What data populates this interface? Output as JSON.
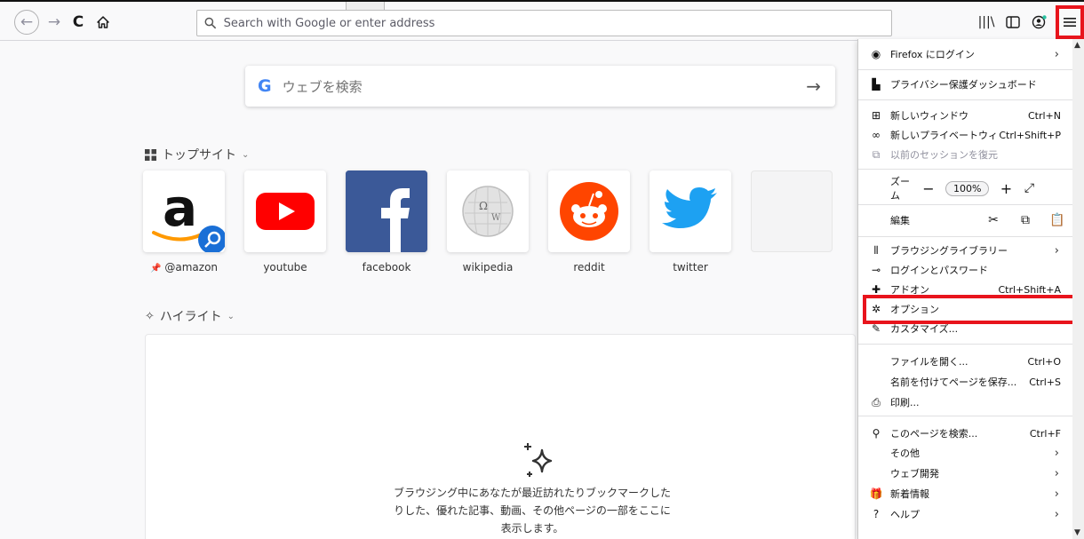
{
  "toolbar": {
    "url_placeholder": "Search with Google or enter address"
  },
  "newtab": {
    "search_placeholder": "ウェブを検索",
    "search_logo": "G",
    "top_sites_title": "トップサイト",
    "highlights_title": "ハイライト",
    "top_sites": [
      {
        "label": "@amazon",
        "pinned": true
      },
      {
        "label": "youtube"
      },
      {
        "label": "facebook"
      },
      {
        "label": "wikipedia"
      },
      {
        "label": "reddit"
      },
      {
        "label": "twitter"
      },
      {
        "label": ""
      }
    ],
    "highlights_empty_line1": "ブラウジング中にあなたが最近訪れたりブックマークした",
    "highlights_empty_line2": "りした、優れた記事、動画、その他ページの一部をここに",
    "highlights_empty_line3": "表示します。"
  },
  "menu": {
    "signin": "Firefox にログイン",
    "privacy_dashboard": "プライバシー保護ダッシュボード",
    "new_window": "新しいウィンドウ",
    "new_window_sc": "Ctrl+N",
    "new_private": "新しいプライベートウィ...",
    "new_private_sc": "Ctrl+Shift+P",
    "restore_session": "以前のセッションを復元",
    "zoom_label": "ズーム",
    "zoom_value": "100%",
    "edit_label": "編集",
    "library": "ブラウジングライブラリー",
    "logins": "ログインとパスワード",
    "addons": "アドオン",
    "addons_sc": "Ctrl+Shift+A",
    "options": "オプション",
    "customize": "カスタマイズ...",
    "open_file": "ファイルを開く...",
    "open_file_sc": "Ctrl+O",
    "save_page": "名前を付けてページを保存...",
    "save_page_sc": "Ctrl+S",
    "print": "印刷...",
    "find": "このページを検索...",
    "find_sc": "Ctrl+F",
    "more": "その他",
    "web_dev": "ウェブ開発",
    "whats_new": "新着情報",
    "help": "ヘルプ"
  },
  "colors": {
    "highlight_red": "#e8141c",
    "youtube_red": "#ff0000",
    "facebook_blue": "#3b5998",
    "reddit_orange": "#ff4500",
    "twitter_blue": "#1da1f2"
  }
}
